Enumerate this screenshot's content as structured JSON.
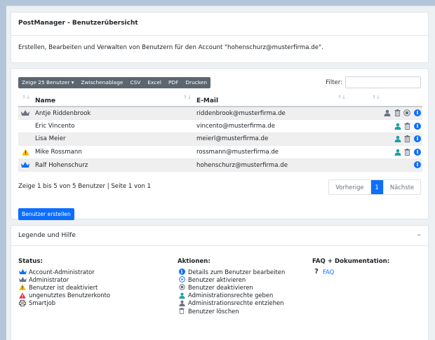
{
  "header": {
    "title": "PostManager - Benutzerübersicht",
    "description": "Erstellen, Bearbeiten und Verwalten von Benutzern für den Account \"hohenschurz@musterfirma.de\"."
  },
  "toolbar": {
    "show_label": "Zeige 25 Benutzer",
    "clipboard": "Zwischenablage",
    "csv": "CSV",
    "excel": "Excel",
    "pdf": "PDF",
    "print": "Drucken",
    "filter_label": "Filter:",
    "filter_value": ""
  },
  "table": {
    "columns": [
      "Name",
      "E-Mail"
    ],
    "rows": [
      {
        "name": "Antje Riddenbrook",
        "email": "riddenbrook@musterfirma.de",
        "status": "admin",
        "actions": [
          "revoke-admin",
          "delete",
          "deactivate",
          "info"
        ]
      },
      {
        "name": "Eric Vincento",
        "email": "vincento@musterfirma.de",
        "status": "",
        "actions": [
          "grant-admin",
          "delete",
          "info"
        ]
      },
      {
        "name": "Lisa Meier",
        "email": "meierl@musterfirma.de",
        "status": "",
        "actions": [
          "grant-admin",
          "delete",
          "info"
        ]
      },
      {
        "name": "Mike Rossmann",
        "email": "rossmann@musterfirma.de",
        "status": "deactivated",
        "actions": [
          "grant-admin",
          "delete",
          "info"
        ]
      },
      {
        "name": "Ralf Hohenschurz",
        "email": "hohenschurz@musterfirma.de",
        "status": "account-admin",
        "actions": [
          "info"
        ]
      }
    ]
  },
  "footer": {
    "status_text": "Zeige 1 bis 5 von 5 Benutzer | Seite 1 von 1",
    "prev": "Vorherige",
    "page": "1",
    "next": "Nächste",
    "create_button": "Benutzer erstellen"
  },
  "legend": {
    "title": "Legende und Hilfe",
    "collapse": "–",
    "status_title": "Status:",
    "status_items": [
      {
        "icon": "crown-blue-icon",
        "label": "Account-Administrator"
      },
      {
        "icon": "crown-gray-icon",
        "label": "Administrator"
      },
      {
        "icon": "warning-yellow-icon",
        "label": "Benutzer ist deaktiviert"
      },
      {
        "icon": "warning-red-icon",
        "label": "ungenutztes Benutzerkonto"
      },
      {
        "icon": "printer-icon",
        "label": "Smartjob"
      }
    ],
    "actions_title": "Aktionen:",
    "action_items": [
      {
        "icon": "info-icon",
        "label": "Details zum Benutzer bearbeiten"
      },
      {
        "icon": "play-circle-icon",
        "label": "Benutzer aktivieren"
      },
      {
        "icon": "stop-circle-icon",
        "label": "Benutzer deaktivieren"
      },
      {
        "icon": "user-teal-icon",
        "label": "Administrationsrechte geben"
      },
      {
        "icon": "user-gray-icon",
        "label": "Administrationsrechte entziehen"
      },
      {
        "icon": "trash-icon",
        "label": "Benutzer löschen"
      }
    ],
    "faq_title": "FAQ + Dokumentation:",
    "faq_mark": "?",
    "faq_link": "FAQ"
  },
  "colors": {
    "primary": "#0d6efd",
    "toolbar": "#5c6670",
    "teal": "#20a0a0",
    "warning": "#f5b800",
    "danger": "#dc3545",
    "background": "#b3c6d9"
  }
}
